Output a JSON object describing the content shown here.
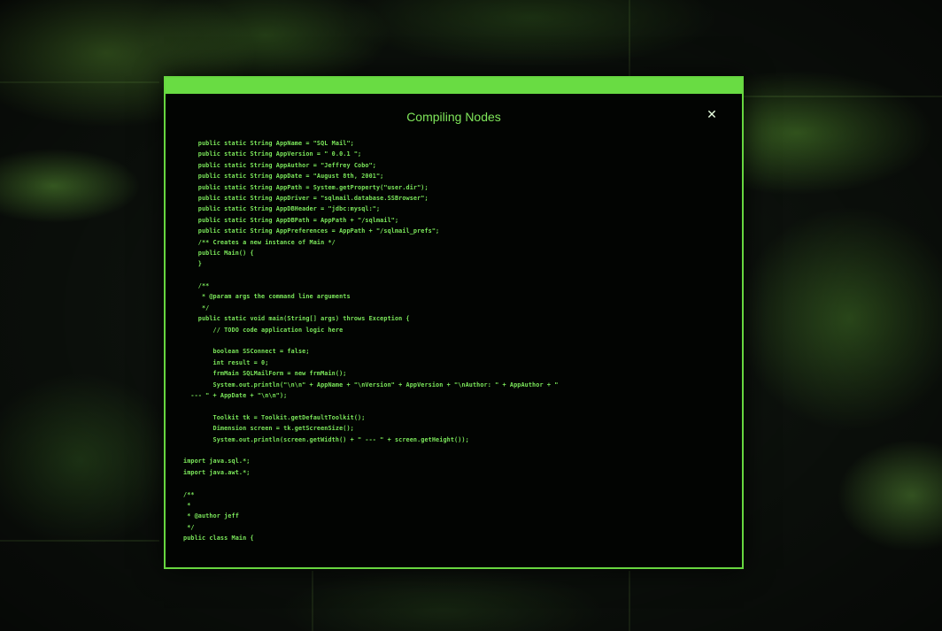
{
  "background": {
    "accent": "#69dc43",
    "description_colors": [
      "#0d120d",
      "#6eb43c"
    ]
  },
  "window": {
    "title": "Compiling Nodes",
    "close_icon": "close-icon",
    "close_glyph": "✕",
    "border_color": "#67d640",
    "text_color": "#7ae55a"
  },
  "code_lines": [
    "    public static String AppName = \"SQL Mail\";",
    "    public static String AppVersion = \" 0.0.1 \";",
    "    public static String AppAuthor = \"Jeffrey Cobo\";",
    "    public static String AppDate = \"August 8th, 2001\";",
    "    public static String AppPath = System.getProperty(\"user.dir\");",
    "    public static String AppDriver = \"sqlmail.database.SSBrowser\";",
    "    public static String AppDBHeader = \"jdbc:mysql:\";",
    "    public static String AppDBPath = AppPath + \"/sqlmail\";",
    "    public static String AppPreferences = AppPath + \"/sqlmail_prefs\";",
    "    /** Creates a new instance of Main */",
    "    public Main() {",
    "    }",
    "",
    "    /**",
    "     * @param args the command line arguments",
    "     */",
    "    public static void main(String[] args) throws Exception {",
    "        // TODO code application logic here",
    "",
    "        boolean SSConnect = false;",
    "        int result = 0;",
    "        frmMain SQLMailForm = new frmMain();",
    "        System.out.println(\"\\n\\n\" + AppName + \"\\nVersion\" + AppVersion + \"\\nAuthor: \" + AppAuthor + \"",
    "  --- \" + AppDate + \"\\n\\n\");",
    "",
    "        Toolkit tk = Toolkit.getDefaultToolkit();",
    "        Dimension screen = tk.getScreenSize();",
    "        System.out.println(screen.getWidth() + \" --- \" + screen.getHeight());",
    "",
    "import java.sql.*;",
    "import java.awt.*;",
    "",
    "/**",
    " *",
    " * @author jeff",
    " */",
    "public class Main {"
  ]
}
